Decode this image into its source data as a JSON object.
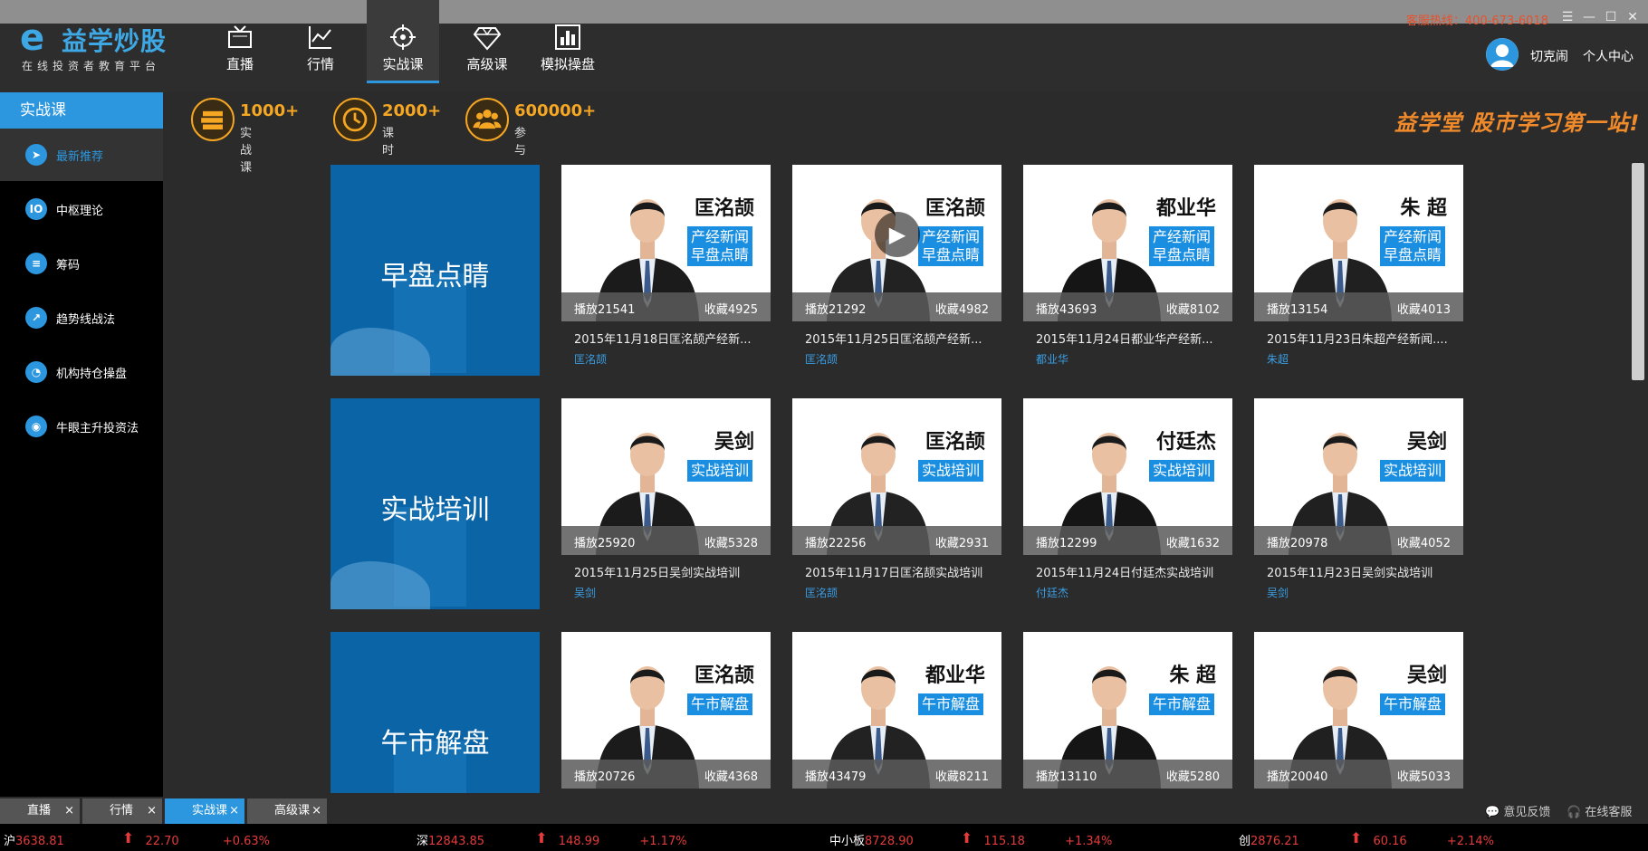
{
  "app": {
    "logo_name": "益学炒股",
    "logo_slogan": "在线投资者教育平台",
    "hotline": "客服热线：400-673-6018"
  },
  "nav": {
    "tabs": [
      {
        "label": "直播",
        "icon": "tv-icon"
      },
      {
        "label": "行情",
        "icon": "line-chart-icon"
      },
      {
        "label": "实战课",
        "icon": "crosshair-icon"
      },
      {
        "label": "高级课",
        "icon": "diamond-icon"
      },
      {
        "label": "模拟操盘",
        "icon": "bar-chart-icon"
      }
    ],
    "active": "实战课"
  },
  "user": {
    "name": "切克闹",
    "center_label": "个人中心"
  },
  "sidebar": {
    "title": "实战课",
    "items": [
      {
        "label": "最新推荐",
        "icon": "navigate-icon"
      },
      {
        "label": "中枢理论",
        "icon": "io-icon"
      },
      {
        "label": "筹码",
        "icon": "database-icon"
      },
      {
        "label": "趋势线战法",
        "icon": "trend-icon"
      },
      {
        "label": "机构持仓操盘",
        "icon": "pie-icon"
      },
      {
        "label": "牛眼主升投资法",
        "icon": "eye-icon"
      }
    ]
  },
  "stats": [
    {
      "value": "1000+",
      "label": "实战课"
    },
    {
      "value": "2000+",
      "label": "课时"
    },
    {
      "value": "600000+",
      "label": "参与"
    }
  ],
  "motto": "益学堂 股市学习第一站!",
  "categories": [
    {
      "label": "早盘点睛",
      "cards": [
        {
          "teacher": "匡洺颉",
          "tag": "产经新闻\n早盘点睛",
          "plays": "播放21541",
          "favs": "收藏4925",
          "title": "2015年11月18日匡洺颉产经新...",
          "name": "匡洺颉"
        },
        {
          "teacher": "匡洺颉",
          "tag": "产经新闻\n早盘点睛",
          "plays": "播放21292",
          "favs": "收藏4982",
          "title": "2015年11月25日匡洺颉产经新...",
          "name": "匡洺颉"
        },
        {
          "teacher": "都业华",
          "tag": "产经新闻\n早盘点睛",
          "plays": "播放43693",
          "favs": "收藏8102",
          "title": "2015年11月24日都业华产经新...",
          "name": "都业华"
        },
        {
          "teacher": "朱 超",
          "tag": "产经新闻\n早盘点睛",
          "plays": "播放13154",
          "favs": "收藏4013",
          "title": "2015年11月23日朱超产经新闻....",
          "name": "朱超"
        }
      ]
    },
    {
      "label": "实战培训",
      "cards": [
        {
          "teacher": "吴剑",
          "tag": "实战培训",
          "plays": "播放25920",
          "favs": "收藏5328",
          "title": "2015年11月25日吴剑实战培训",
          "name": "吴剑"
        },
        {
          "teacher": "匡洺颉",
          "tag": "实战培训",
          "plays": "播放22256",
          "favs": "收藏2931",
          "title": "2015年11月17日匡洺颉实战培训",
          "name": "匡洺颉"
        },
        {
          "teacher": "付廷杰",
          "tag": "实战培训",
          "plays": "播放12299",
          "favs": "收藏1632",
          "title": "2015年11月24日付廷杰实战培训",
          "name": "付廷杰"
        },
        {
          "teacher": "吴剑",
          "tag": "实战培训",
          "plays": "播放20978",
          "favs": "收藏4052",
          "title": "2015年11月23日吴剑实战培训",
          "name": "吴剑"
        }
      ]
    },
    {
      "label": "午市解盘",
      "cards": [
        {
          "teacher": "匡洺颉",
          "tag": "午市解盘",
          "plays": "播放20726",
          "favs": "收藏4368",
          "title": "",
          "name": ""
        },
        {
          "teacher": "都业华",
          "tag": "午市解盘",
          "plays": "播放43479",
          "favs": "收藏8211",
          "title": "",
          "name": ""
        },
        {
          "teacher": "朱 超",
          "tag": "午市解盘",
          "plays": "播放13110",
          "favs": "收藏5280",
          "title": "",
          "name": ""
        },
        {
          "teacher": "吴剑",
          "tag": "午市解盘",
          "plays": "播放20040",
          "favs": "收藏5033",
          "title": "",
          "name": ""
        }
      ]
    }
  ],
  "bottom_tabs": [
    {
      "label": "直播",
      "close": "×"
    },
    {
      "label": "行情",
      "close": "×"
    },
    {
      "label": "实战课",
      "close": "×"
    },
    {
      "label": "高级课",
      "close": "×"
    }
  ],
  "bottom_links": {
    "feedback": "意见反馈",
    "service": "在线客服"
  },
  "ticker": [
    {
      "label": "沪",
      "index": "3638.81",
      "change": "22.70",
      "pct": "+0.63%"
    },
    {
      "label": "深",
      "index": "12843.85",
      "change": "148.99",
      "pct": "+1.17%"
    },
    {
      "label": "中小板",
      "index": "8728.90",
      "change": "115.18",
      "pct": "+1.34%"
    },
    {
      "label": "创",
      "index": "2876.21",
      "change": "60.16",
      "pct": "+2.14%"
    }
  ],
  "colors": {
    "accent": "#2c97de",
    "stat_orange": "#f5a623",
    "up_red": "#e43b3b",
    "tile_blue": "#0a64a6"
  }
}
